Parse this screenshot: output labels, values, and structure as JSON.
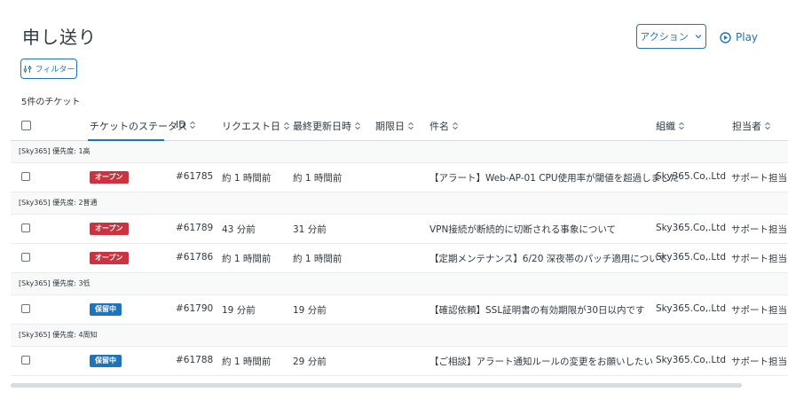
{
  "page": {
    "title": "申し送り",
    "action_label": "アクション",
    "play_label": "Play",
    "filter_label": "フィルター",
    "ticket_count": "5件のチケット"
  },
  "columns": [
    "チケットのステータス",
    "ID",
    "リクエスト日",
    "最終更新日時",
    "期限日",
    "件名",
    "組織",
    "担当者"
  ],
  "colors": {
    "accent": "#1f73b7",
    "open": "#cc3340",
    "hold": "#1f73b7"
  },
  "groups": [
    {
      "label": "[Sky365] 優先度: 1高",
      "rows": [
        {
          "status": "オープン",
          "status_type": "open",
          "id": "#61785",
          "requested": "約 1 時間前",
          "updated": "約 1 時間前",
          "due": "",
          "subject": "【アラート】Web-AP-01 CPU使用率が閾値を超過しました",
          "org": "Sky365.Co,.Ltd",
          "assignee": "サポート担当 i"
        }
      ]
    },
    {
      "label": "[Sky365] 優先度: 2普通",
      "rows": [
        {
          "status": "オープン",
          "status_type": "open",
          "id": "#61789",
          "requested": "43 分前",
          "updated": "31 分前",
          "due": "",
          "subject": "VPN接続が断続的に切断される事象について",
          "org": "Sky365.Co,.Ltd",
          "assignee": "サポート担当 i"
        },
        {
          "status": "オープン",
          "status_type": "open",
          "id": "#61786",
          "requested": "約 1 時間前",
          "updated": "約 1 時間前",
          "due": "",
          "subject": "【定期メンテナンス】6/20 深夜帯のパッチ適用について",
          "org": "Sky365.Co,.Ltd",
          "assignee": "サポート担当 i"
        }
      ]
    },
    {
      "label": "[Sky365] 優先度: 3低",
      "rows": [
        {
          "status": "保留中",
          "status_type": "hold",
          "id": "#61790",
          "requested": "19 分前",
          "updated": "19 分前",
          "due": "",
          "subject": "【確認依頼】SSL証明書の有効期限が30日以内です",
          "org": "Sky365.Co,.Ltd",
          "assignee": "サポート担当 i"
        }
      ]
    },
    {
      "label": "[Sky365] 優先度: 4周知",
      "rows": [
        {
          "status": "保留中",
          "status_type": "hold",
          "id": "#61788",
          "requested": "約 1 時間前",
          "updated": "29 分前",
          "due": "",
          "subject": "【ご相談】アラート通知ルールの変更をお願いしたい",
          "org": "Sky365.Co,.Ltd",
          "assignee": "サポート担当 i"
        }
      ]
    }
  ]
}
